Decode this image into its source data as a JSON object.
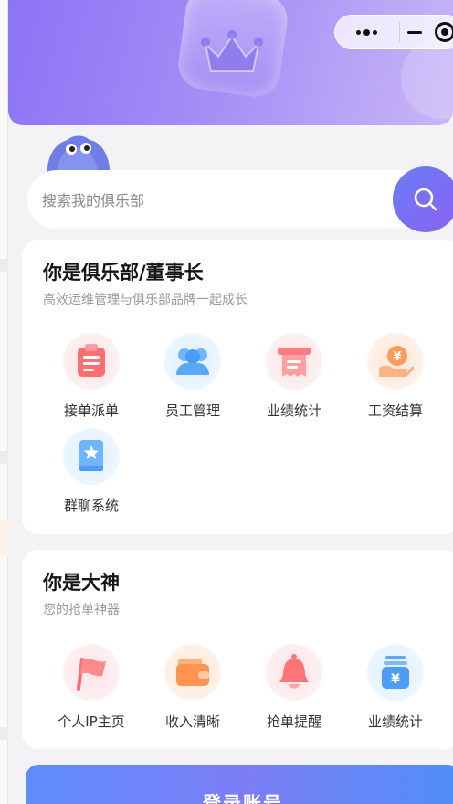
{
  "search": {
    "placeholder": "搜索我的俱乐部"
  },
  "club_card": {
    "title": "你是俱乐部/董事长",
    "subtitle": "高效运维管理与俱乐部品牌一起成长",
    "items": [
      {
        "label": "接单派单",
        "icon": "clipboard-icon"
      },
      {
        "label": "员工管理",
        "icon": "users-icon"
      },
      {
        "label": "业绩统计",
        "icon": "receipt-icon"
      },
      {
        "label": "工资结算",
        "icon": "salary-hand-icon"
      },
      {
        "label": "群聊系统",
        "icon": "chat-badge-icon"
      }
    ]
  },
  "god_card": {
    "title": "你是大神",
    "subtitle": "您的抢单神器",
    "items": [
      {
        "label": "个人IP主页",
        "icon": "flag-icon"
      },
      {
        "label": "收入清晰",
        "icon": "wallet-icon"
      },
      {
        "label": "抢单提醒",
        "icon": "bell-icon"
      },
      {
        "label": "业绩统计",
        "icon": "money-stack-icon"
      }
    ]
  },
  "login": {
    "label": "登录账号"
  },
  "colors": {
    "banner": "#8d73f7",
    "accent_purple": "#7b6cf4",
    "login_blue": "#5f8dfb"
  }
}
